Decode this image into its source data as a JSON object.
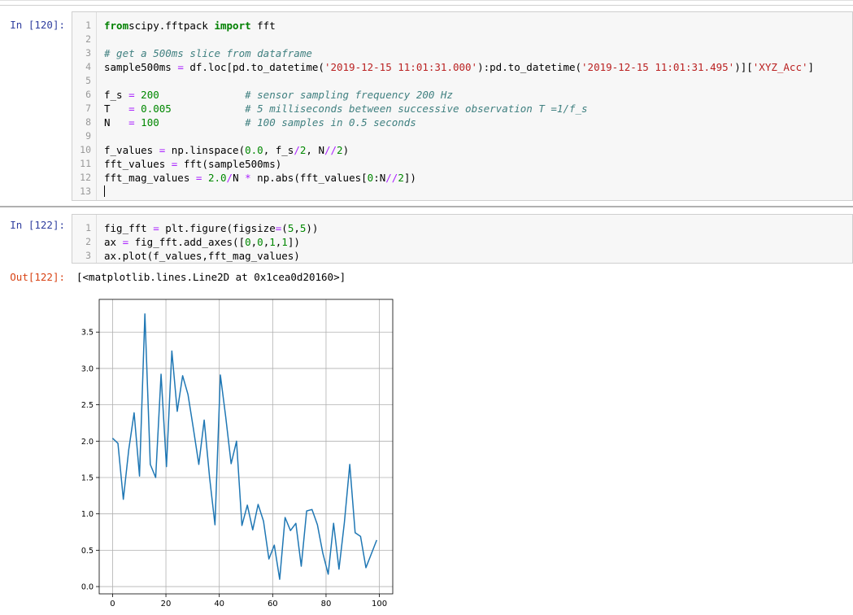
{
  "cells": [
    {
      "prompt": "In [120]:",
      "lines": [
        [
          [
            "kw",
            "from"
          ],
          [
            "",
            "scipy.fftpack "
          ],
          [
            "kw",
            "import"
          ],
          [
            "",
            " fft"
          ]
        ],
        [],
        [
          [
            "cm",
            "# get a 500ms slice from dataframe"
          ]
        ],
        [
          [
            "",
            "sample500ms "
          ],
          [
            "op",
            "="
          ],
          [
            "",
            " df.loc[pd.to_datetime("
          ],
          [
            "st",
            "'2019-12-15 11:01:31.000'"
          ],
          [
            "",
            "):pd.to_datetime("
          ],
          [
            "st",
            "'2019-12-15 11:01:31.495'"
          ],
          [
            "",
            ")]["
          ],
          [
            "st",
            "'XYZ_Acc'"
          ],
          [
            "",
            "]"
          ]
        ],
        [],
        [
          [
            "",
            "f_s "
          ],
          [
            "op",
            "="
          ],
          [
            "",
            " "
          ],
          [
            "nm",
            "200"
          ],
          [
            "",
            "              "
          ],
          [
            "cm",
            "# sensor sampling frequency 200 Hz"
          ]
        ],
        [
          [
            "",
            "T   "
          ],
          [
            "op",
            "="
          ],
          [
            "",
            " "
          ],
          [
            "nm",
            "0.005"
          ],
          [
            "",
            "            "
          ],
          [
            "cm",
            "# 5 milliseconds between successive observation T =1/f_s"
          ]
        ],
        [
          [
            "",
            "N   "
          ],
          [
            "op",
            "="
          ],
          [
            "",
            " "
          ],
          [
            "nm",
            "100"
          ],
          [
            "",
            "              "
          ],
          [
            "cm",
            "# 100 samples in 0.5 seconds"
          ]
        ],
        [],
        [
          [
            "",
            "f_values "
          ],
          [
            "op",
            "="
          ],
          [
            "",
            " np.linspace("
          ],
          [
            "nm",
            "0.0"
          ],
          [
            "",
            ", f_s"
          ],
          [
            "op",
            "/"
          ],
          [
            "nm",
            "2"
          ],
          [
            "",
            ", N"
          ],
          [
            "op",
            "//"
          ],
          [
            "nm",
            "2"
          ],
          [
            "",
            ")"
          ]
        ],
        [
          [
            "",
            "fft_values "
          ],
          [
            "op",
            "="
          ],
          [
            "",
            " fft(sample500ms)"
          ]
        ],
        [
          [
            "",
            "fft_mag_values "
          ],
          [
            "op",
            "="
          ],
          [
            "",
            " "
          ],
          [
            "nm",
            "2.0"
          ],
          [
            "op",
            "/"
          ],
          [
            "",
            "N "
          ],
          [
            "op",
            "*"
          ],
          [
            "",
            " np.abs(fft_values["
          ],
          [
            "nm",
            "0"
          ],
          [
            "",
            ":N"
          ],
          [
            "op",
            "//"
          ],
          [
            "nm",
            "2"
          ],
          [
            "",
            "])"
          ]
        ],
        []
      ],
      "line_numbers": [
        "1",
        "2",
        "3",
        "4",
        "5",
        "6",
        "7",
        "8",
        "9",
        "10",
        "11",
        "12",
        "13"
      ]
    },
    {
      "prompt": "In [122]:",
      "lines": [
        [
          [
            "",
            "fig_fft "
          ],
          [
            "op",
            "="
          ],
          [
            "",
            " plt.figure(figsize"
          ],
          [
            "op",
            "="
          ],
          [
            "",
            "("
          ],
          [
            "nm",
            "5"
          ],
          [
            "",
            ","
          ],
          [
            "nm",
            "5"
          ],
          [
            "",
            "))"
          ]
        ],
        [
          [
            "",
            "ax "
          ],
          [
            "op",
            "="
          ],
          [
            "",
            " fig_fft.add_axes(["
          ],
          [
            "nm",
            "0"
          ],
          [
            "",
            ","
          ],
          [
            "nm",
            "0"
          ],
          [
            "",
            ","
          ],
          [
            "nm",
            "1"
          ],
          [
            "",
            ","
          ],
          [
            "nm",
            "1"
          ],
          [
            "",
            "])"
          ]
        ],
        [
          [
            "",
            "ax.plot(f_values,fft_mag_values)"
          ]
        ]
      ],
      "line_numbers": [
        "1",
        "2",
        "3"
      ]
    }
  ],
  "output": {
    "prompt": "Out[122]:",
    "text": "[<matplotlib.lines.Line2D at 0x1cea0d20160>]"
  },
  "colors": {
    "line": "#1f77b4",
    "grid": "#b0b0b0",
    "prompt_in": "#303f9f",
    "prompt_out": "#d84315"
  },
  "chart_data": {
    "type": "line",
    "title": "",
    "xlabel": "",
    "ylabel": "",
    "grid": true,
    "xlim": [
      -5,
      105
    ],
    "ylim": [
      -0.1,
      3.95
    ],
    "x_ticks": [
      0,
      20,
      40,
      60,
      80,
      100
    ],
    "x_tick_labels": [
      "0",
      "20",
      "40",
      "60",
      "80",
      "100"
    ],
    "y_ticks": [
      0.0,
      0.5,
      1.0,
      1.5,
      2.0,
      2.5,
      3.0,
      3.5
    ],
    "y_tick_labels": [
      "0.0",
      "0.5",
      "1.0",
      "1.5",
      "2.0",
      "2.5",
      "3.0",
      "3.5"
    ],
    "series": [
      {
        "x": [
          0,
          2.02,
          4.04,
          6.06,
          8.08,
          10.1,
          12.12,
          14.14,
          16.16,
          18.18,
          20.2,
          22.22,
          24.24,
          26.26,
          28.28,
          30.3,
          32.32,
          34.34,
          36.36,
          38.38,
          40.4,
          42.42,
          44.44,
          46.46,
          48.48,
          50.51,
          52.53,
          54.55,
          56.57,
          58.59,
          60.61,
          62.63,
          64.65,
          66.67,
          68.69,
          70.71,
          72.73,
          74.75,
          76.77,
          78.79,
          80.81,
          82.83,
          84.85,
          86.87,
          88.89,
          90.91,
          92.93,
          94.95,
          96.97,
          98.99
        ],
        "y": [
          2.04,
          1.97,
          1.2,
          1.88,
          2.39,
          1.52,
          3.75,
          1.68,
          1.5,
          2.92,
          1.65,
          3.24,
          2.41,
          2.9,
          2.64,
          2.17,
          1.68,
          2.29,
          1.5,
          0.85,
          2.91,
          2.33,
          1.69,
          2.0,
          0.84,
          1.12,
          0.78,
          1.13,
          0.9,
          0.38,
          0.57,
          0.1,
          0.95,
          0.77,
          0.87,
          0.28,
          1.04,
          1.06,
          0.85,
          0.46,
          0.17,
          0.87,
          0.24,
          0.88,
          1.68,
          0.74,
          0.69,
          0.26,
          0.45,
          0.64
        ]
      }
    ]
  }
}
